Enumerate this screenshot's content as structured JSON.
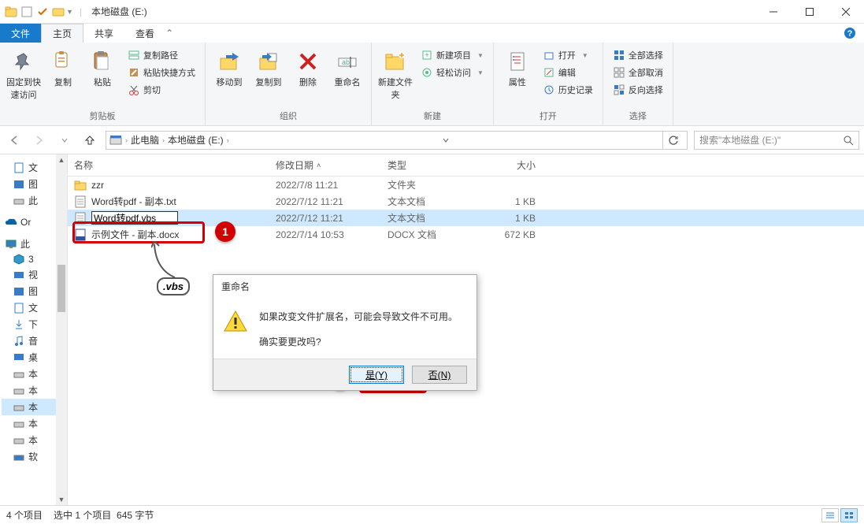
{
  "titlebar": {
    "title": "本地磁盘 (E:)"
  },
  "tabs": {
    "file": "文件",
    "home": "主页",
    "share": "共享",
    "view": "查看"
  },
  "ribbon": {
    "pin": "固定到快速访问",
    "copy": "复制",
    "paste": "粘贴",
    "copypath": "复制路径",
    "pasteshortcut": "粘贴快捷方式",
    "cut": "剪切",
    "group_clipboard": "剪贴板",
    "moveto": "移动到",
    "copyto": "复制到",
    "delete": "删除",
    "rename": "重命名",
    "group_organize": "组织",
    "newfolder": "新建文件夹",
    "newitem": "新建项目",
    "easyaccess": "轻松访问",
    "group_new": "新建",
    "properties": "属性",
    "open": "打开",
    "edit": "编辑",
    "history": "历史记录",
    "group_open": "打开",
    "selectall": "全部选择",
    "selectnone": "全部取消",
    "invertselect": "反向选择",
    "group_select": "选择"
  },
  "address": {
    "thispc": "此电脑",
    "drive": "本地磁盘 (E:)"
  },
  "search": {
    "placeholder": "搜索\"本地磁盘 (E:)\""
  },
  "columns": {
    "name": "名称",
    "date": "修改日期",
    "type": "类型",
    "size": "大小"
  },
  "files": {
    "r0": {
      "name": "zzr",
      "date": "2022/7/8 11:21",
      "type": "文件夹",
      "size": ""
    },
    "r1": {
      "name": "Word转pdf - 副本.txt",
      "date": "2022/7/12 11:21",
      "type": "文本文档",
      "size": "1 KB"
    },
    "r2": {
      "name": "Word转pdf.vbs",
      "date": "2022/7/12 11:21",
      "type": "文本文档",
      "size": "1 KB"
    },
    "r3": {
      "name": "示例文件 - 副本.docx",
      "date": "2022/7/14 10:53",
      "type": "DOCX 文档",
      "size": "672 KB"
    }
  },
  "nav": {
    "i0": "文",
    "i1": "图",
    "i2": "此",
    "i3": "Or",
    "i4": "此",
    "i5": "3",
    "i6": "视",
    "i7": "图",
    "i8": "文",
    "i9": "下",
    "i10": "音",
    "i11": "桌",
    "i12": "本",
    "i13": "本",
    "i14": "本",
    "i15": "本",
    "i16": "本",
    "i17": "软"
  },
  "dialog": {
    "title": "重命名",
    "line1": "如果改变文件扩展名，可能会导致文件不可用。",
    "line2": "确实要更改吗?",
    "yes": "是(Y)",
    "no": "否(N)"
  },
  "callout_vbs": ".vbs",
  "status": {
    "items": "4 个项目",
    "selected": "选中 1 个项目",
    "bytes": "645 字节"
  }
}
